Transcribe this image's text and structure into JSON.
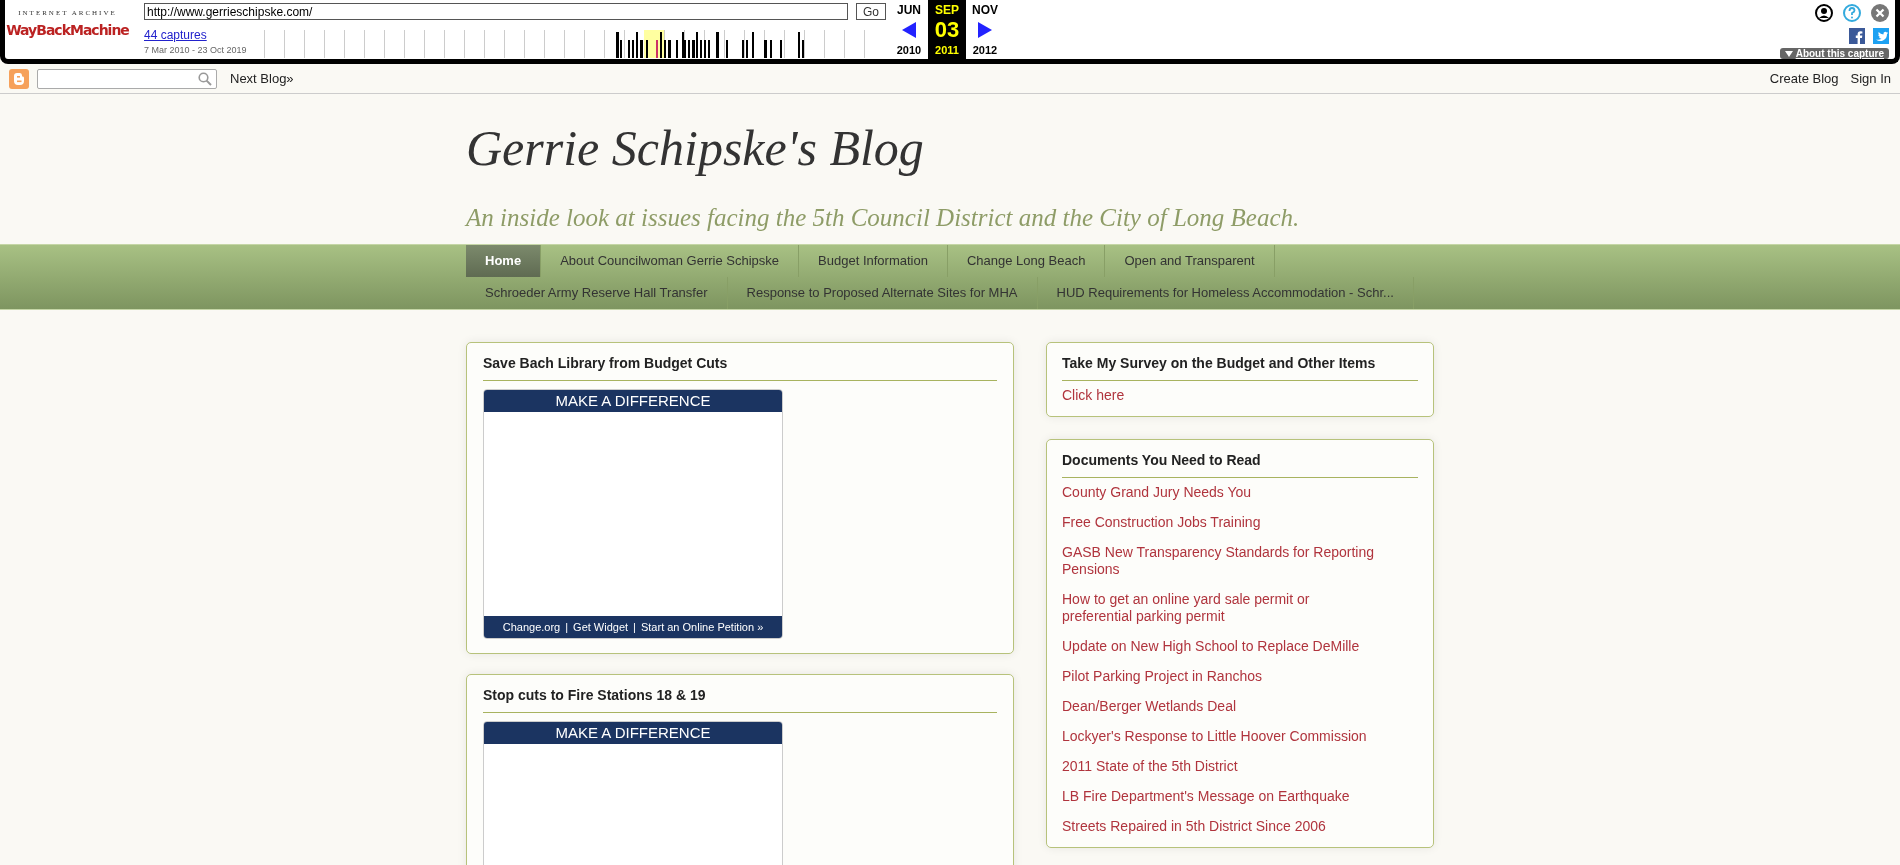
{
  "wayback": {
    "logo_caption": "INTERNET ARCHIVE",
    "logo_text": "WayBackMachine",
    "url": "http://www.gerrieschipske.com/",
    "go_label": "Go",
    "captures_link": "44 captures",
    "date_range": "7 Mar 2010 - 23 Oct 2019",
    "months": [
      {
        "month": "JUN",
        "year": "2010",
        "selected": false
      },
      {
        "month": "SEP",
        "day": "03",
        "year": "2011",
        "selected": true
      },
      {
        "month": "NOV",
        "year": "2012",
        "selected": false
      }
    ],
    "about_label": "About this capture"
  },
  "blogger_bar": {
    "next_blog": "Next Blog»",
    "links": [
      "Create Blog",
      "Sign In"
    ]
  },
  "header": {
    "title": "Gerrie Schipske's Blog",
    "subtitle": "An inside look at issues facing the 5th Council District and the City of Long Beach."
  },
  "nav": {
    "tabs": [
      {
        "label": "Home",
        "selected": true
      },
      {
        "label": "About Councilwoman Gerrie Schipske",
        "selected": false
      },
      {
        "label": "Budget Information",
        "selected": false
      },
      {
        "label": "Change Long Beach",
        "selected": false
      },
      {
        "label": "Open and Transparent",
        "selected": false
      },
      {
        "label": "Schroeder Army Reserve Hall Transfer",
        "selected": false
      },
      {
        "label": "Response to Proposed Alternate Sites for MHA",
        "selected": false
      },
      {
        "label": "HUD Requirements for Homeless Accommodation - Schr...",
        "selected": false
      }
    ]
  },
  "main": {
    "posts": [
      {
        "title": "Save Bach Library from Budget Cuts",
        "widget": {
          "header": "MAKE A DIFFERENCE",
          "footer_links": [
            "Change.org",
            "Get Widget",
            "Start an Online Petition »"
          ],
          "separator": "|"
        }
      },
      {
        "title": "Stop cuts to Fire Stations 18 & 19",
        "widget": {
          "header": "MAKE A DIFFERENCE"
        }
      }
    ]
  },
  "sidebar": [
    {
      "title": "Take My Survey on the Budget and Other Items",
      "links": [
        "Click here"
      ]
    },
    {
      "title": "Documents You Need to Read",
      "links": [
        "County Grand Jury Needs You",
        "Free Construction Jobs Training",
        "GASB New Transparency Standards for Reporting Pensions",
        "How to get an online yard sale permit or preferential parking permit",
        "Update on New High School to Replace DeMille",
        "Pilot Parking Project in Ranchos",
        "Dean/Berger Wetlands Deal",
        "Lockyer's Response to Little Hoover Commission",
        "2011 State of the 5th District",
        "LB Fire Department's Message on Earthquake",
        "Streets Repaired in 5th District Since 2006"
      ]
    }
  ]
}
